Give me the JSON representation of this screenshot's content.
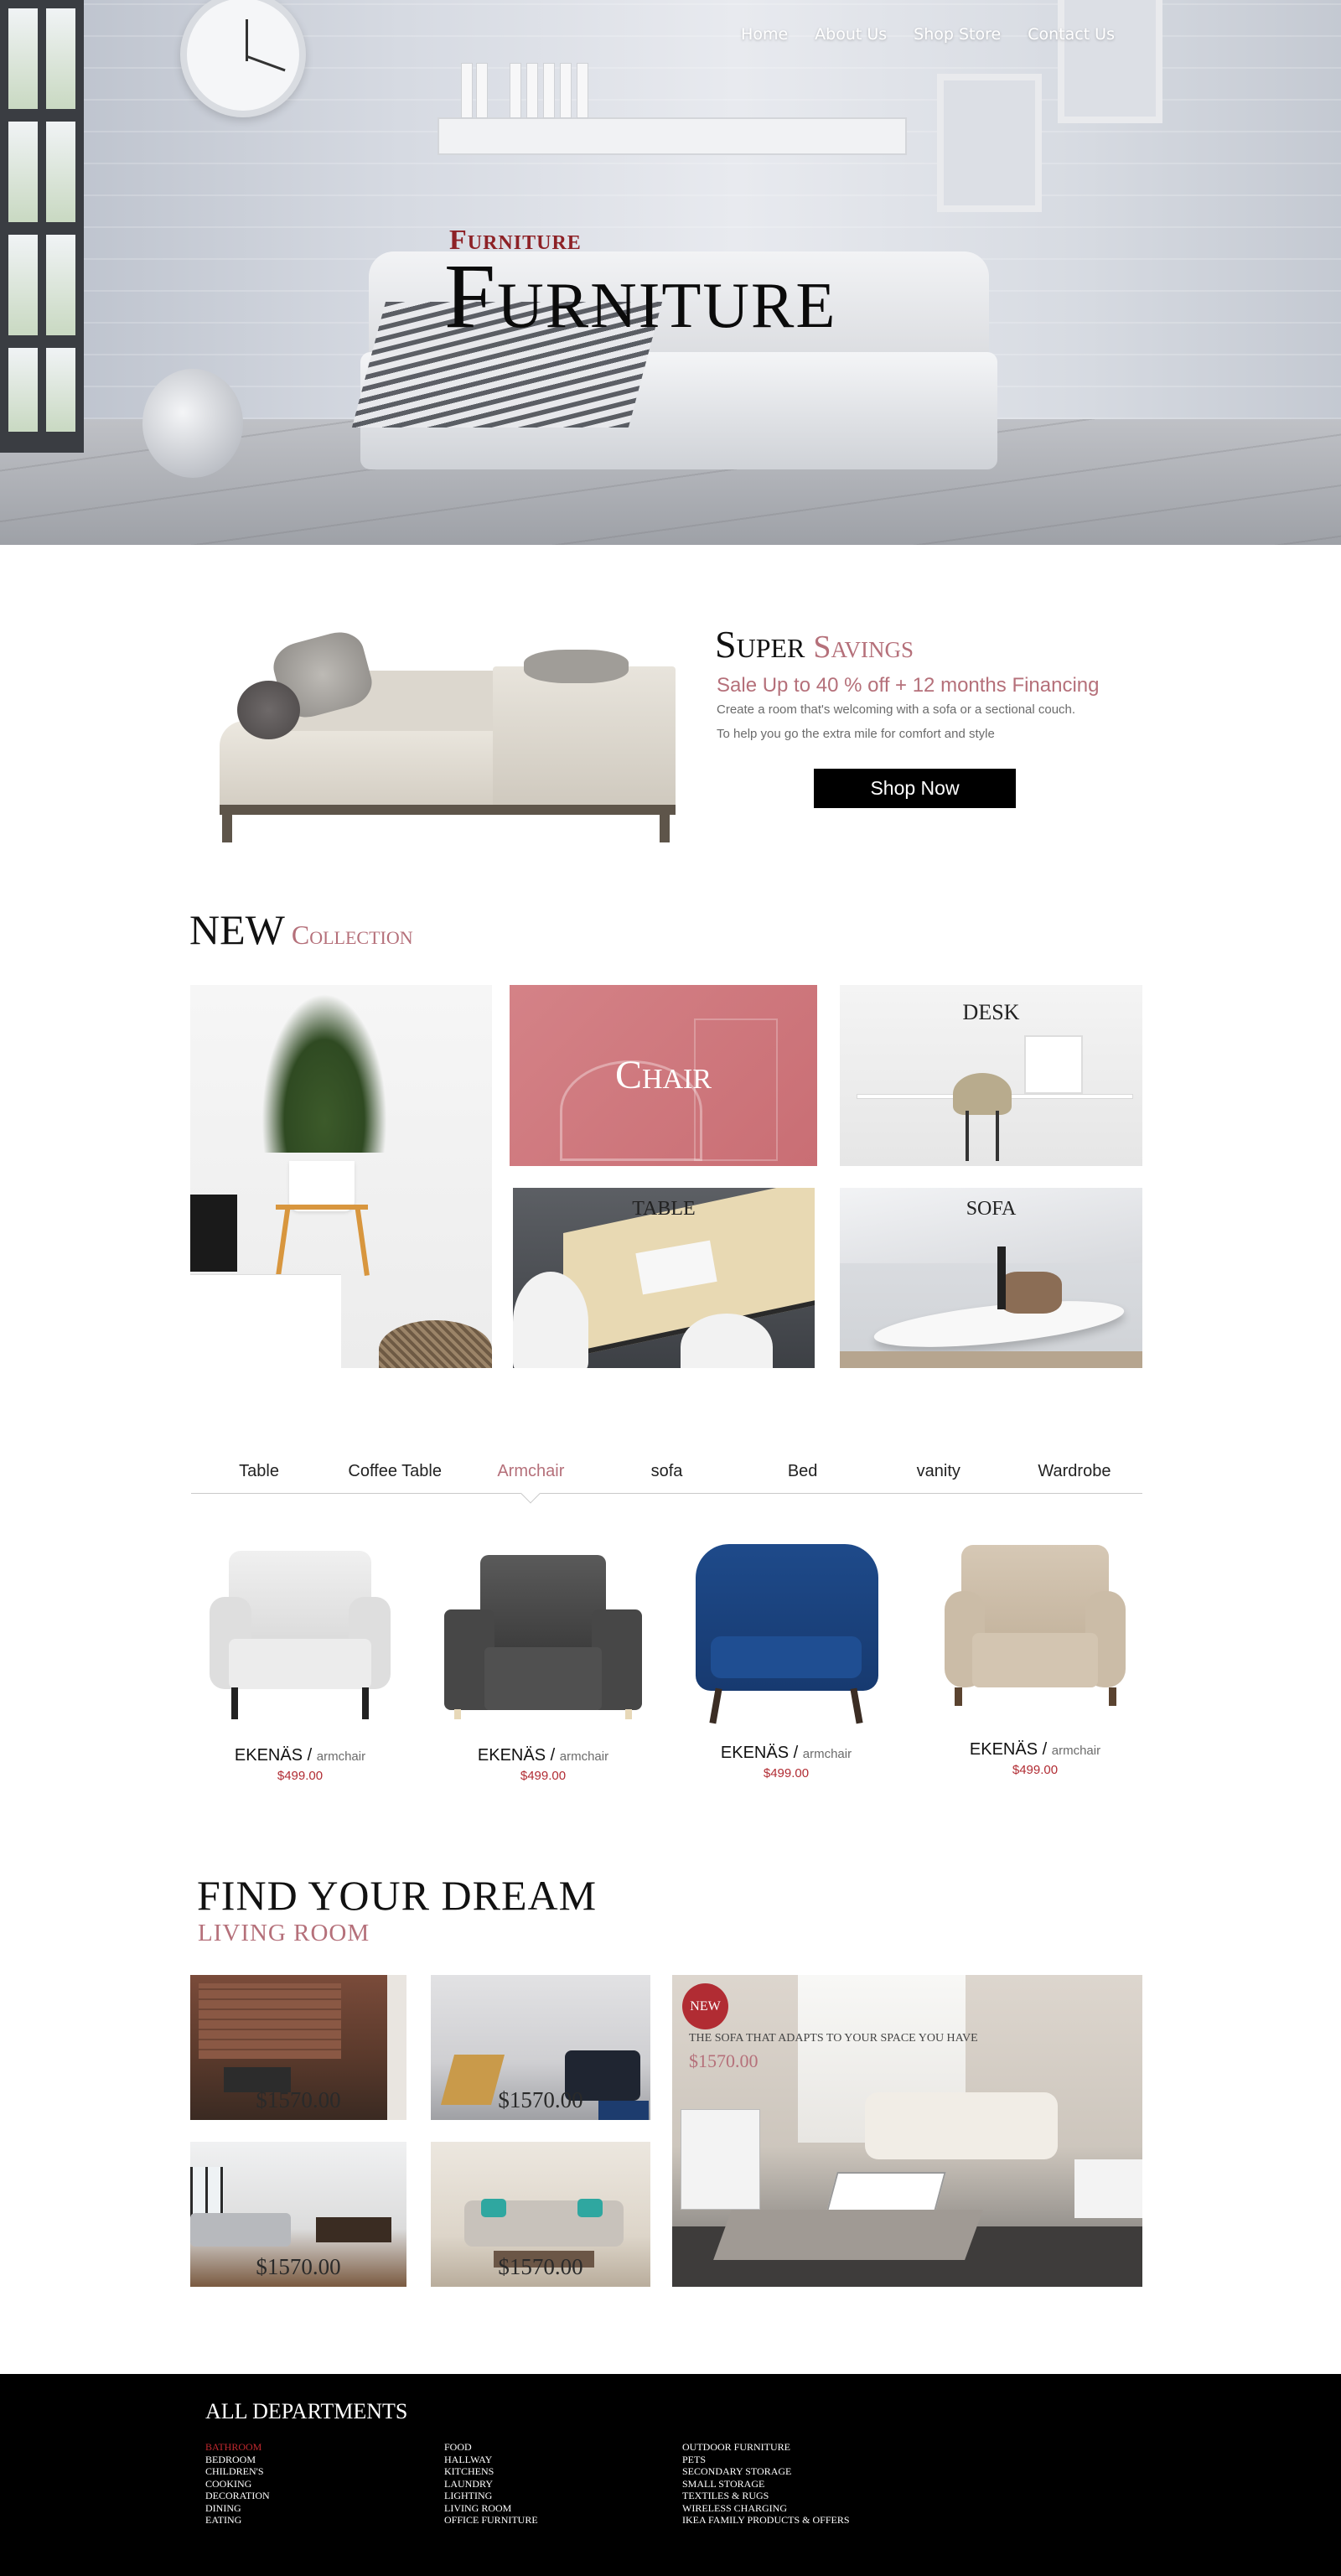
{
  "nav": {
    "items": [
      "Home",
      "About Us",
      "Shop Store",
      "Contact Us"
    ]
  },
  "hero": {
    "kicker": "Furniture",
    "title": "Furniture"
  },
  "savings": {
    "title": "Super",
    "title_accent": "Savings",
    "subtitle": "Sale Up to 40 % off + 12 months Financing",
    "line1": "Create a room that's welcoming with a sofa or a sectional couch.",
    "line2": "To help you go the extra mile for comfort and style",
    "button": "Shop Now"
  },
  "new_collection": {
    "title": "NEW",
    "title_accent": "Collection",
    "tiles": [
      "Chair",
      "Desk",
      "Table",
      "Sofa"
    ]
  },
  "tabs": {
    "items": [
      "Table",
      "Coffee Table",
      "Armchair",
      "sofa",
      "Bed",
      "vanity",
      "Wardrobe"
    ],
    "active": "Armchair"
  },
  "products": [
    {
      "name": "EKENÄS /",
      "type": "armchair",
      "price": "$499.00"
    },
    {
      "name": "EKENÄS /",
      "type": "armchair",
      "price": "$499.00"
    },
    {
      "name": "EKENÄS /",
      "type": "armchair",
      "price": "$499.00"
    },
    {
      "name": "EKENÄS /",
      "type": "armchair",
      "price": "$499.00"
    }
  ],
  "colors": {
    "accent": "#b5707a",
    "price_red": "#b12c33",
    "kicker_red": "#8d2126"
  },
  "dream": {
    "title": "Find your dream",
    "subtitle": "Living room",
    "room_prices": [
      "$1570.00",
      "$1570.00",
      "$1570.00",
      "$1570.00"
    ],
    "badge": "NEW",
    "feature_caption": "The sofa that adapts to your space you have",
    "feature_price": "$1570.00"
  },
  "footer": {
    "title": "All Departments",
    "col1": [
      "Bathroom",
      "Bedroom",
      "Children's",
      "Cooking",
      "Decoration",
      "Dining",
      "Eating"
    ],
    "col2": [
      "Food",
      "Hallway",
      "Kitchens",
      "Laundry",
      "Lighting",
      "Living room",
      "Office furniture"
    ],
    "col3": [
      "Outdoor furniture",
      "Pets",
      "Secondary storage",
      "Small storage",
      "Textiles & rugs",
      "Wireless charging",
      "IKEA family products & offers"
    ]
  }
}
